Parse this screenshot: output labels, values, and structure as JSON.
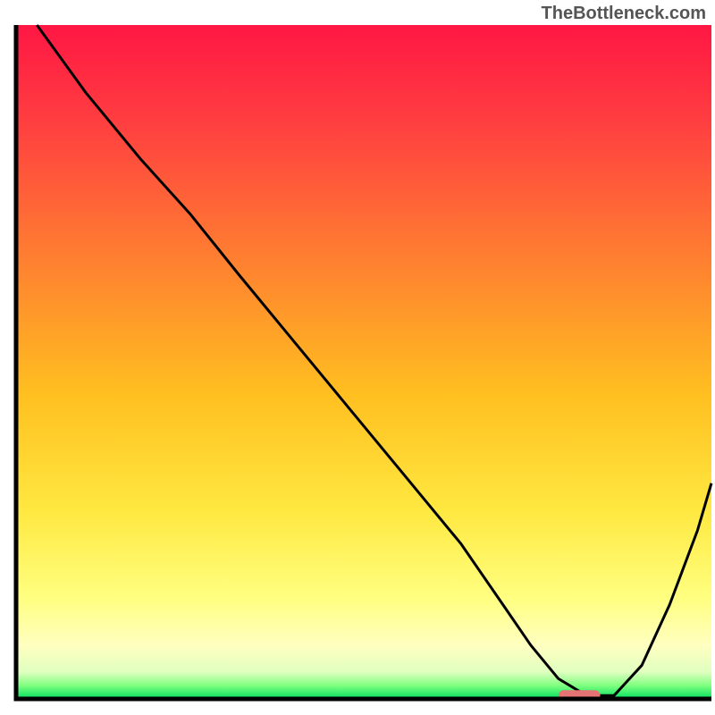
{
  "watermark": "TheBottleneck.com",
  "chart_data": {
    "type": "line",
    "title": "",
    "xlabel": "",
    "ylabel": "",
    "xlim": [
      0,
      100
    ],
    "ylim": [
      0,
      100
    ],
    "background": {
      "type": "vertical_gradient",
      "stops": [
        {
          "offset": 0,
          "color": "#ff1744"
        },
        {
          "offset": 15,
          "color": "#ff4040"
        },
        {
          "offset": 35,
          "color": "#ff8030"
        },
        {
          "offset": 55,
          "color": "#ffc020"
        },
        {
          "offset": 72,
          "color": "#ffe840"
        },
        {
          "offset": 85,
          "color": "#ffff80"
        },
        {
          "offset": 92,
          "color": "#ffffc0"
        },
        {
          "offset": 96,
          "color": "#e0ffc0"
        },
        {
          "offset": 98,
          "color": "#80ff80"
        },
        {
          "offset": 100,
          "color": "#00e060"
        }
      ]
    },
    "series": [
      {
        "name": "bottleneck-curve",
        "color": "#000000",
        "x": [
          3,
          10,
          18,
          25,
          32,
          40,
          48,
          56,
          64,
          70,
          74,
          78,
          82,
          86,
          90,
          94,
          98,
          100
        ],
        "y": [
          100,
          90,
          80,
          72,
          63,
          53,
          43,
          33,
          23,
          14,
          8,
          3,
          0.5,
          0.5,
          5,
          14,
          25,
          32
        ]
      }
    ],
    "marker": {
      "name": "optimal-zone",
      "x_start": 78,
      "x_end": 84,
      "y": 0.5,
      "color": "#e57373"
    },
    "axes": {
      "show_ticks": false,
      "border_color": "#000000",
      "border_width": 2
    }
  }
}
